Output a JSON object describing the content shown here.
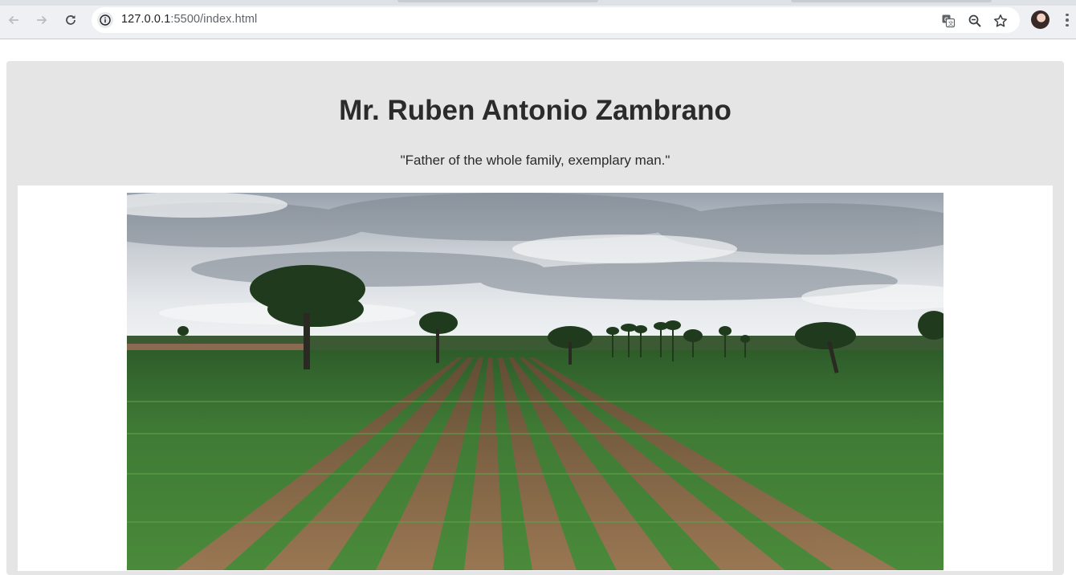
{
  "browser": {
    "url_host": "127.0.0.1",
    "url_path": ":5500/index.html",
    "nav": {
      "back_icon": "arrow-left-icon",
      "forward_icon": "arrow-right-icon",
      "reload_icon": "reload-icon"
    },
    "actions": [
      "translate-icon",
      "zoom-icon",
      "star-icon"
    ]
  },
  "page": {
    "title": "Mr. Ruben Antonio Zambrano",
    "quote": "\"Father of the whole family, exemplary man.\"",
    "image": {
      "subject": "corn field with trees under a cloudy sky"
    }
  },
  "colors": {
    "card_background": "#e5e5e5",
    "text": "#2b2b2b",
    "chrome_background": "#eef0f3"
  }
}
